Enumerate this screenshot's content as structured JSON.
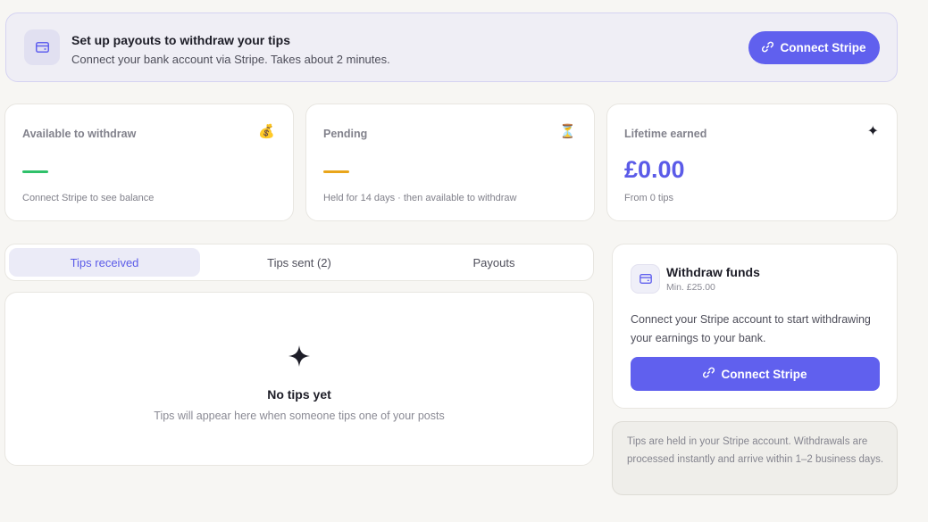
{
  "banner": {
    "icon": "credit-card-icon",
    "title": "Set up payouts to withdraw your tips",
    "subtitle": "Connect your bank account via Stripe. Takes about 2 minutes.",
    "button_label": "Connect Stripe",
    "button_icon": "link-icon"
  },
  "stats": [
    {
      "label": "Available to withdraw",
      "emoji": "💰",
      "note": "Connect Stripe to see balance",
      "dash_color": "#2fc16a"
    },
    {
      "label": "Pending",
      "emoji": "⏳",
      "note": "Held for 14 days · then available to withdraw",
      "dash_color": "#e9a51a"
    },
    {
      "label": "Lifetime earned",
      "emoji": "✦",
      "value": "£0.00",
      "note": "From 0 tips"
    }
  ],
  "tabs": [
    {
      "label": "Tips received",
      "active": true
    },
    {
      "label": "Tips sent (2)",
      "active": false
    },
    {
      "label": "Payouts",
      "active": false
    }
  ],
  "empty_state": {
    "icon": "sparkle-icon",
    "title": "No tips yet",
    "subtitle": "Tips will appear here when someone tips one of your posts"
  },
  "withdraw": {
    "icon": "credit-card-icon",
    "title": "Withdraw funds",
    "min": "Min. £25.00",
    "description": "Connect your Stripe account to start withdrawing your earnings to your bank.",
    "button_label": "Connect Stripe",
    "button_icon": "link-icon"
  },
  "note": {
    "text": "Tips are held in your Stripe account. Withdrawals are processed instantly and arrive within 1–2 business days."
  },
  "colors": {
    "accent": "#6060ee",
    "accent_text": "#5b5be8",
    "green": "#2fc16a",
    "amber": "#e9a51a"
  }
}
